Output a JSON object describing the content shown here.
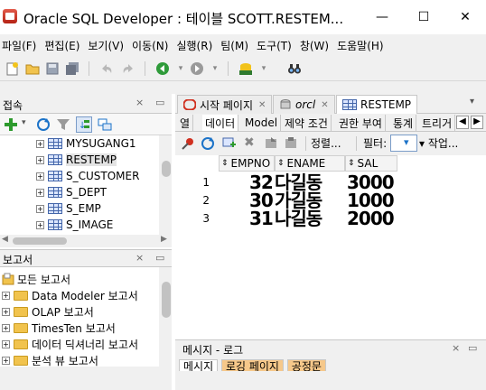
{
  "window": {
    "title": "Oracle SQL Developer : 테이블 SCOTT.RESTEM...",
    "minimize": "—",
    "maximize": "☐",
    "close": "✕"
  },
  "menu": [
    "파일(F)",
    "편집(E)",
    "보기(V)",
    "이동(N)",
    "실행(R)",
    "팀(M)",
    "도구(T)",
    "창(W)",
    "도움말(H)"
  ],
  "toolbar": {
    "icons": [
      "new-icon",
      "open-icon",
      "save-icon",
      "save-all-icon",
      "undo-icon",
      "redo-icon",
      "back-icon",
      "forward-icon",
      "sql-worksheet-icon",
      "binoculars-icon"
    ]
  },
  "connections": {
    "title": "접속",
    "tree": [
      {
        "label": "MYSUGANG1"
      },
      {
        "label": "RESTEMP",
        "selected": true
      },
      {
        "label": "S_CUSTOMER"
      },
      {
        "label": "S_DEPT"
      },
      {
        "label": "S_EMP"
      },
      {
        "label": "S_IMAGE"
      }
    ]
  },
  "reports": {
    "title": "보고서",
    "items": [
      {
        "label": "모든 보고서"
      },
      {
        "label": "Data Modeler 보고서"
      },
      {
        "label": "OLAP 보고서"
      },
      {
        "label": "TimesTen 보고서"
      },
      {
        "label": "데이터 딕셔너리 보고서"
      },
      {
        "label": "분석 뷰 보고서"
      }
    ]
  },
  "editor": {
    "tabs": [
      {
        "label": "시작 페이지"
      },
      {
        "label": "orcl"
      },
      {
        "label": "RESTEMP",
        "active": true
      }
    ],
    "subtabs": [
      "열",
      "데이터",
      "Model",
      "제약 조건",
      "권한 부여",
      "통계",
      "트리거"
    ],
    "active_subtab": "데이터",
    "grid_toolbar": {
      "sort_label": "정렬...",
      "filter_label": "필터:",
      "actions_label": "▾ 작업..."
    },
    "columns": [
      "EMPNO",
      "ENAME",
      "SAL"
    ],
    "rows": [
      {
        "num": "1",
        "empno": "32",
        "ename": "다길동",
        "sal": "3000"
      },
      {
        "num": "2",
        "empno": "30",
        "ename": "가길동",
        "sal": "1000"
      },
      {
        "num": "3",
        "empno": "31",
        "ename": "나길동",
        "sal": "2000"
      }
    ]
  },
  "messages": {
    "title": "메시지 - 로그",
    "tabs": [
      "메시지",
      "로깅 페이지",
      "공정문"
    ]
  },
  "colors": {
    "accent": "#1c73c8",
    "selection": "#e3e3e3",
    "panel": "#f0f0f0"
  }
}
